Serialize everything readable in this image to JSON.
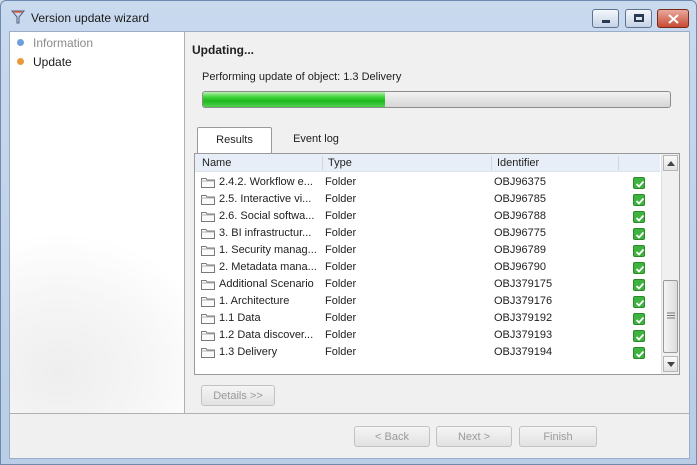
{
  "window": {
    "title": "Version update wizard"
  },
  "sidebar": {
    "steps": [
      {
        "label": "Information",
        "state": "done"
      },
      {
        "label": "Update",
        "state": "current"
      }
    ]
  },
  "main": {
    "heading": "Updating...",
    "progress_text": "Performing update of object: 1.3 Delivery",
    "progress_fraction": 0.39,
    "tabs": [
      {
        "label": "Results",
        "active": true
      },
      {
        "label": "Event log",
        "active": false
      }
    ],
    "table": {
      "columns": [
        "Name",
        "Type",
        "Identifier"
      ],
      "rows": [
        {
          "name": "2.4.2. Workflow e...",
          "type": "Folder",
          "id": "OBJ96375"
        },
        {
          "name": "2.5. Interactive vi...",
          "type": "Folder",
          "id": "OBJ96785"
        },
        {
          "name": "2.6. Social softwa...",
          "type": "Folder",
          "id": "OBJ96788"
        },
        {
          "name": "3. BI infrastructur...",
          "type": "Folder",
          "id": "OBJ96775"
        },
        {
          "name": "1. Security manag...",
          "type": "Folder",
          "id": "OBJ96789"
        },
        {
          "name": "2. Metadata mana...",
          "type": "Folder",
          "id": "OBJ96790"
        },
        {
          "name": "Additional Scenario",
          "type": "Folder",
          "id": "OBJ379175"
        },
        {
          "name": "1. Architecture",
          "type": "Folder",
          "id": "OBJ379176"
        },
        {
          "name": "1.1 Data",
          "type": "Folder",
          "id": "OBJ379192"
        },
        {
          "name": "1.2 Data discover...",
          "type": "Folder",
          "id": "OBJ379193"
        },
        {
          "name": "1.3 Delivery",
          "type": "Folder",
          "id": "OBJ379194"
        }
      ]
    },
    "details_button": "Details >>"
  },
  "footer": {
    "back_label": "< Back",
    "next_label": "Next >",
    "finish_label": "Finish"
  },
  "colors": {
    "progress_green": "#20b820",
    "check_green": "#3fb33f",
    "step_done_dot": "#6fa0dd",
    "step_current_dot": "#e89a3a"
  }
}
